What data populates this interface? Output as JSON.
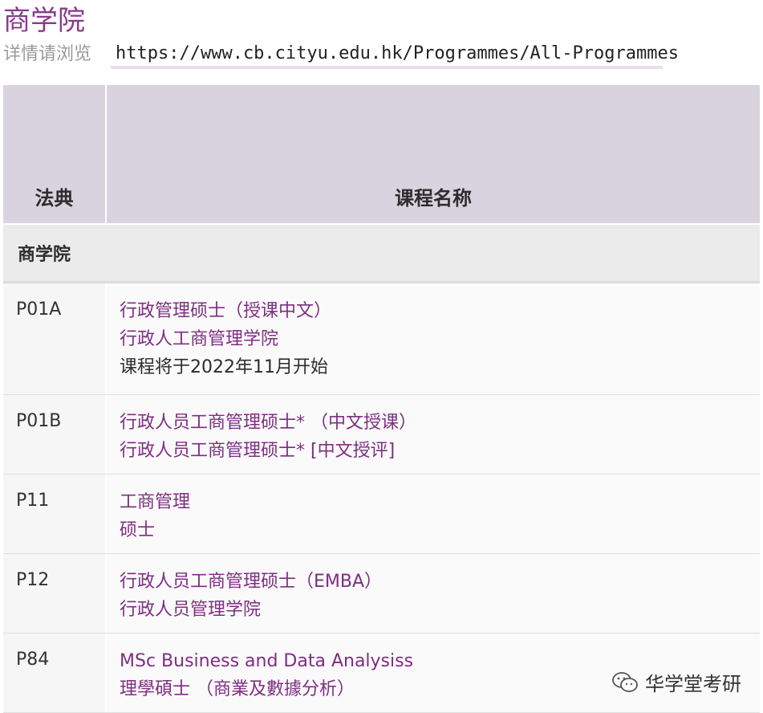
{
  "title": "商学院",
  "url_prefix": "详情请浏览",
  "url": "https://www.cb.cityu.edu.hk/Programmes/All-Programmes",
  "table": {
    "header_code": "法典",
    "header_name": "课程名称",
    "section": "商学院",
    "rows": [
      {
        "code": "P01A",
        "lines": [
          "行政管理硕士（授课中文）",
          "行政人工商管理学院",
          "课程将于2022年11月开始"
        ],
        "height": 138
      },
      {
        "code": "P01B",
        "lines": [
          "行政人员工商管理硕士* （中文授课）",
          "行政人员工商管理硕士* [中文授评]"
        ],
        "height": 98
      },
      {
        "code": "P11",
        "lines": [
          "工商管理",
          "硕士"
        ],
        "height": 98
      },
      {
        "code": "P12",
        "lines": [
          "行政人员工商管理硕士（EMBA）",
          "行政人员管理学院"
        ],
        "height": 98
      },
      {
        "code": "P84",
        "lines": [
          "MSc Business and Data Analysiss",
          "理學碩士 （商業及數據分析）"
        ],
        "height": 98
      }
    ]
  },
  "watermark": {
    "icon": "wechat-icon",
    "text": "华学堂考研"
  },
  "colors": {
    "title": "#8a3a8c",
    "link": "#7e2e82",
    "header_bg": "#d9d3df",
    "section_bg": "#ebebeb"
  }
}
